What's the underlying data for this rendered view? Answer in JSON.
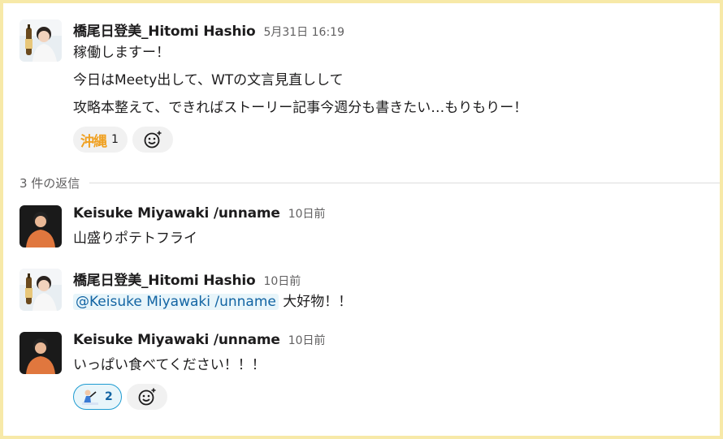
{
  "thread": {
    "parent": {
      "sender": "橋尾日登美_Hitomi Hashio",
      "time": "5月31日 16:19",
      "lines": [
        "稼働しますー！",
        "今日はMeety出して、WTの文言見直しして",
        "攻略本整えて、できればストーリー記事今週分も書きたい…もりもりー！"
      ],
      "reactions": [
        {
          "emoji_text": "沖縄",
          "count": "1"
        }
      ]
    },
    "reply_divider": "3 件の返信",
    "replies": [
      {
        "sender": "Keisuke Miyawaki /unname",
        "time": "10日前",
        "text": "山盛りポテトフライ"
      },
      {
        "sender": "橋尾日登美_Hitomi Hashio",
        "time": "10日前",
        "mention": "@Keisuke Miyawaki /unname",
        "text": "大好物！！"
      },
      {
        "sender": "Keisuke Miyawaki /unname",
        "time": "10日前",
        "text": "いっぱい食べてください！！！",
        "reactions": [
          {
            "emoji": "person-icon",
            "count": "2"
          }
        ]
      }
    ]
  },
  "colors": {
    "frame": "#f7e9a8",
    "mention": "#1264a3",
    "active_reaction_border": "#1d9bd1"
  }
}
